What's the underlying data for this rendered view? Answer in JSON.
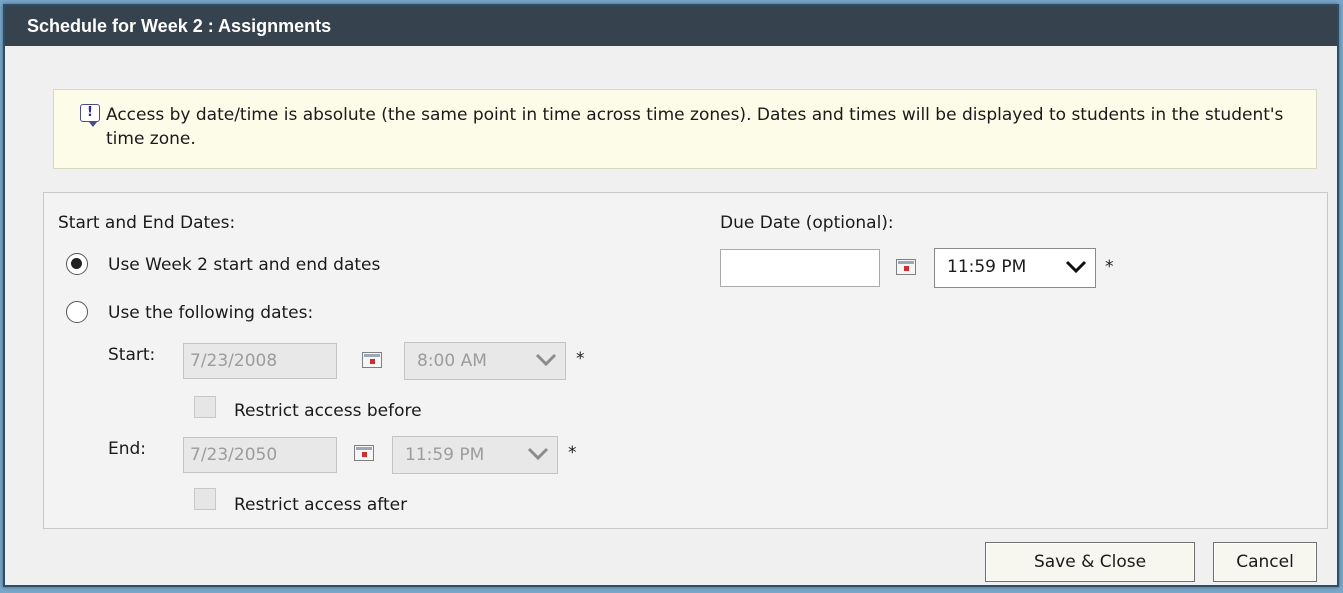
{
  "dialog": {
    "title": "Schedule for Week 2 : Assignments"
  },
  "info": {
    "icon": "info-speech-icon",
    "message": "Access by date/time is absolute (the same point in time across time zones). Dates and times will be displayed to students in the student's time zone."
  },
  "start_end": {
    "heading": "Start and End Dates:",
    "option_week": "Use Week 2 start and end dates",
    "option_following": "Use the following dates:",
    "selected": "week",
    "start_label": "Start:",
    "start_date": "7/23/2008",
    "start_time": "8:00 AM",
    "restrict_before": "Restrict access before",
    "end_label": "End:",
    "end_date": "7/23/2050",
    "end_time": "11:59 PM",
    "restrict_after": "Restrict access after",
    "required_marker": "*"
  },
  "due": {
    "heading": "Due Date (optional):",
    "date": "",
    "time": "11:59 PM",
    "required_marker": "*"
  },
  "buttons": {
    "save_close": "Save & Close",
    "cancel": "Cancel"
  }
}
